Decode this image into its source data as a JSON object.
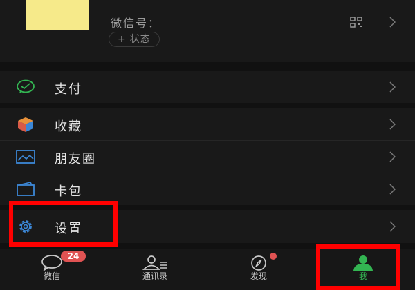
{
  "profile": {
    "wechat_id_label": "微信号：",
    "status_button": "状态",
    "status_plus": "+"
  },
  "menu": {
    "pay": "支付",
    "favorites": "收藏",
    "moments": "朋友圈",
    "card_wallet": "卡包",
    "settings": "设置"
  },
  "tabbar": {
    "chats": {
      "label": "微信",
      "badge": "24"
    },
    "contacts": {
      "label": "通讯录"
    },
    "discover": {
      "label": "发现"
    },
    "me": {
      "label": "我"
    }
  },
  "colors": {
    "background": "#111111",
    "row": "#191919",
    "accent_green": "#33b552",
    "highlight_red": "#ff0000",
    "badge_red": "#e05353"
  },
  "icons": {
    "pay": "wechat-pay-icon",
    "favorites": "cube-icon",
    "moments": "picture-icon",
    "card_wallet": "card-icon",
    "settings": "gear-icon"
  }
}
